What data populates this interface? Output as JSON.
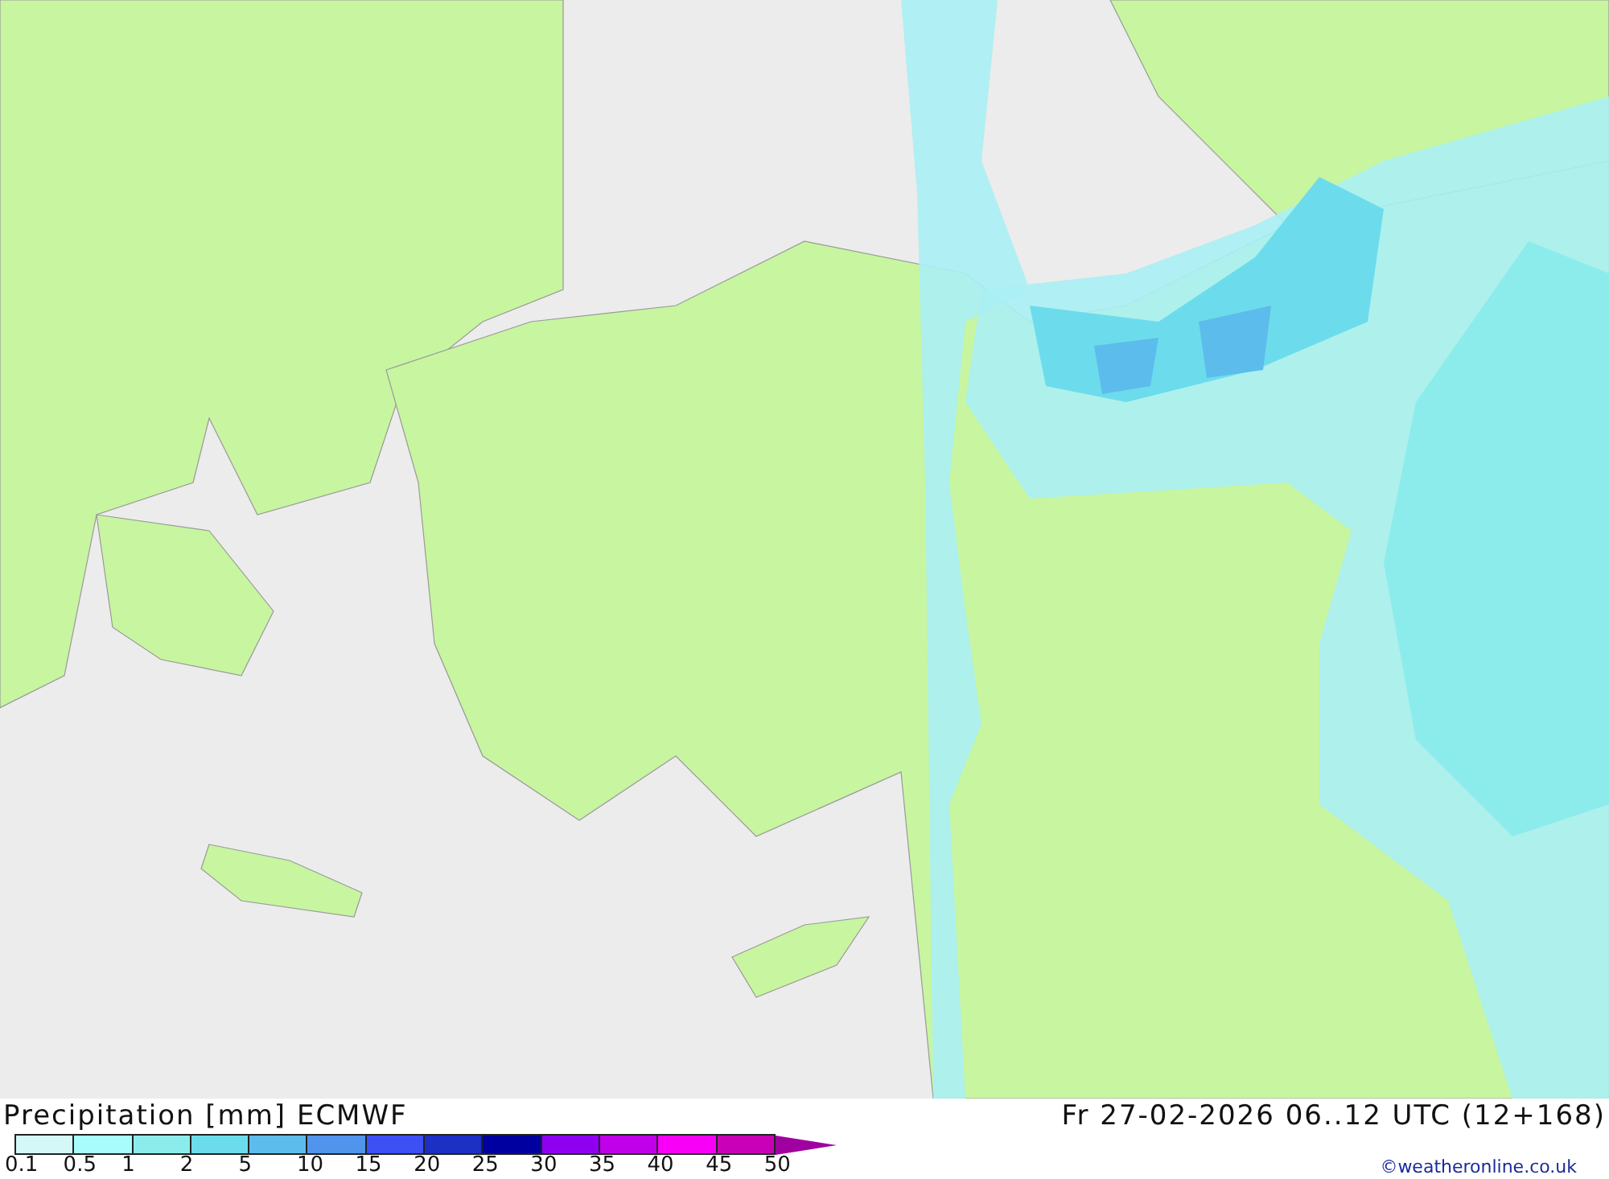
{
  "map": {
    "title": "Precipitation [mm] ECMWF",
    "valid_time": "Fr 27-02-2026 06..12 UTC (12+168)"
  },
  "legend": {
    "segments": [
      {
        "color": "#d4f8f8"
      },
      {
        "color": "#a8fcfc"
      },
      {
        "color": "#8cecec"
      },
      {
        "color": "#6cdcec"
      },
      {
        "color": "#5cbcec"
      },
      {
        "color": "#5094ec"
      },
      {
        "color": "#3c50f4"
      },
      {
        "color": "#1c30c4"
      },
      {
        "color": "#0000a0"
      },
      {
        "color": "#9000f0"
      },
      {
        "color": "#c000e8"
      },
      {
        "color": "#f800f8"
      },
      {
        "color": "#c800b8"
      }
    ],
    "ticks": [
      "0.1",
      "0.5",
      "1",
      "2",
      "5",
      "10",
      "15",
      "20",
      "25",
      "30",
      "35",
      "40",
      "45",
      "50"
    ]
  },
  "credit": "©weatheronline.co.uk"
}
